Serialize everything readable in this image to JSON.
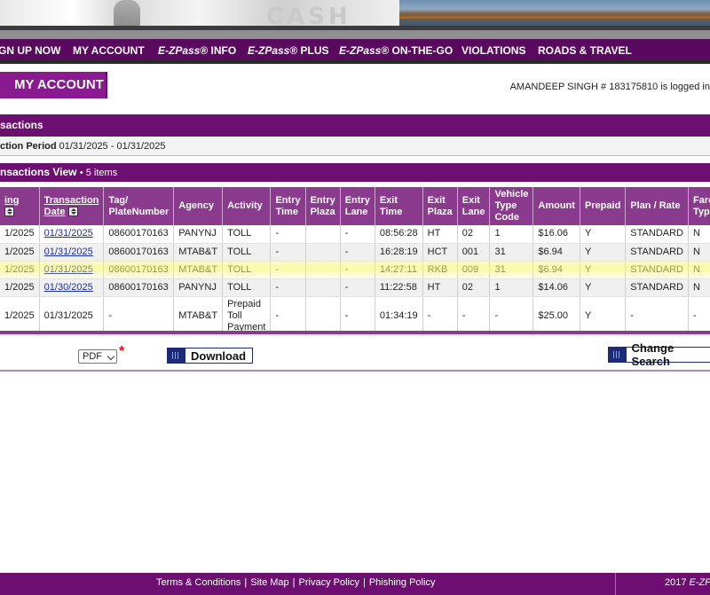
{
  "banner": {
    "overlay_text": "CASH"
  },
  "nav": {
    "items": [
      {
        "prefix": "",
        "label": "GN UP NOW"
      },
      {
        "prefix": "",
        "label": "MY ACCOUNT"
      },
      {
        "prefix": "E-ZPass",
        "label": "® INFO"
      },
      {
        "prefix": "E-ZPass",
        "label": "® PLUS"
      },
      {
        "prefix": "E-ZPass",
        "label": "® ON-THE-GO"
      },
      {
        "prefix": "",
        "label": "VIOLATIONS"
      },
      {
        "prefix": "",
        "label": "ROADS & TRAVEL"
      }
    ]
  },
  "account": {
    "tab_label": "MY ACCOUNT",
    "logged_in_text": "AMANDEEP SINGH # 183175810 is logged in"
  },
  "transactions": {
    "header": "sactions",
    "period_label": "ction Period",
    "period_value": "01/31/2025 - 01/31/2025",
    "view_title": "nsactions View",
    "item_count": "• 5 items"
  },
  "table": {
    "headers": [
      "ing",
      "Transaction Date",
      "Tag/ PlateNumber",
      "Agency",
      "Activity",
      "Entry Time",
      "Entry Plaza",
      "Entry Lane",
      "Exit Time",
      "Exit Plaza",
      "Exit Lane",
      "Vehicle Type Code",
      "Amount",
      "Prepaid",
      "Plan / Rate",
      "Fare Type"
    ],
    "rows": [
      [
        "1/2025",
        "01/31/2025",
        "08600170163",
        "PANYNJ",
        "TOLL",
        "-",
        "",
        "-",
        "08:56:28",
        "HT",
        "02",
        "1",
        "$16.06",
        "Y",
        "STANDARD",
        "N"
      ],
      [
        "1/2025",
        "01/31/2025",
        "08600170163",
        "MTAB&T",
        "TOLL",
        "-",
        "",
        "-",
        "16:28:19",
        "HCT",
        "001",
        "31",
        "$6.94",
        "Y",
        "STANDARD",
        "N"
      ],
      [
        "1/2025",
        "01/31/2025",
        "08600170163",
        "MTAB&T",
        "TOLL",
        "-",
        "",
        "-",
        "14:27:11",
        "RKB",
        "009",
        "31",
        "$6.94",
        "Y",
        "STANDARD",
        "N"
      ],
      [
        "1/2025",
        "01/30/2025",
        "08600170163",
        "PANYNJ",
        "TOLL",
        "-",
        "",
        "-",
        "11:22:58",
        "HT",
        "02",
        "1",
        "$14.06",
        "Y",
        "STANDARD",
        "N"
      ],
      [
        "1/2025",
        "01/31/2025",
        "-",
        "MTAB&T",
        "Prepaid Toll Payment",
        "-",
        "",
        "-",
        "01:34:19",
        "-",
        "-",
        "-",
        "$25.00",
        "Y",
        "-",
        "-"
      ]
    ]
  },
  "export": {
    "format_selected": "PDF",
    "required_mark": "*",
    "download_label": "Download",
    "change_search_label": "Change Search"
  },
  "footer": {
    "links": [
      "Terms & Conditions",
      "Site Map",
      "Privacy Policy",
      "Phishing Policy"
    ],
    "separator": "|",
    "copyright_year": "2017",
    "copyright_brand": "E-ZPa"
  },
  "colors": {
    "nav_bg": "#5a0a5e",
    "section_bg": "#6d0f70",
    "header_bg": "#8a3b8d",
    "tab_bg": "#8a1a8f",
    "link": "#1a2fa0"
  }
}
